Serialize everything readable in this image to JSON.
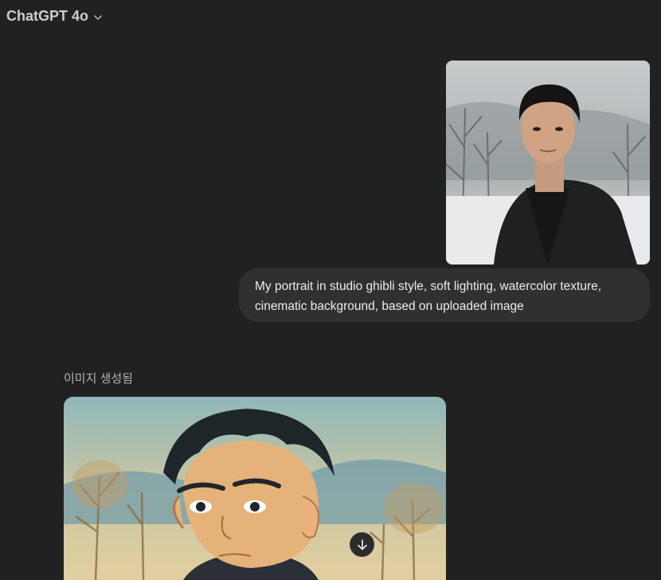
{
  "header": {
    "model_name": "ChatGPT 4o",
    "dropdown_icon": "chevron-down-icon"
  },
  "conversation": {
    "user_message": {
      "attachment": "uploaded-portrait-photo",
      "text": "My portrait in studio ghibli style, soft lighting, watercolor texture, cinematic background, based on uploaded image"
    },
    "assistant_message": {
      "status_label": "이미지 생성됨",
      "image": "generated-ghibli-portrait"
    }
  },
  "controls": {
    "scroll_down_icon": "arrow-down-icon"
  },
  "colors": {
    "background": "#212121",
    "user_bubble": "#303030",
    "text_primary": "#ececec",
    "text_secondary": "#b4b4b4"
  }
}
